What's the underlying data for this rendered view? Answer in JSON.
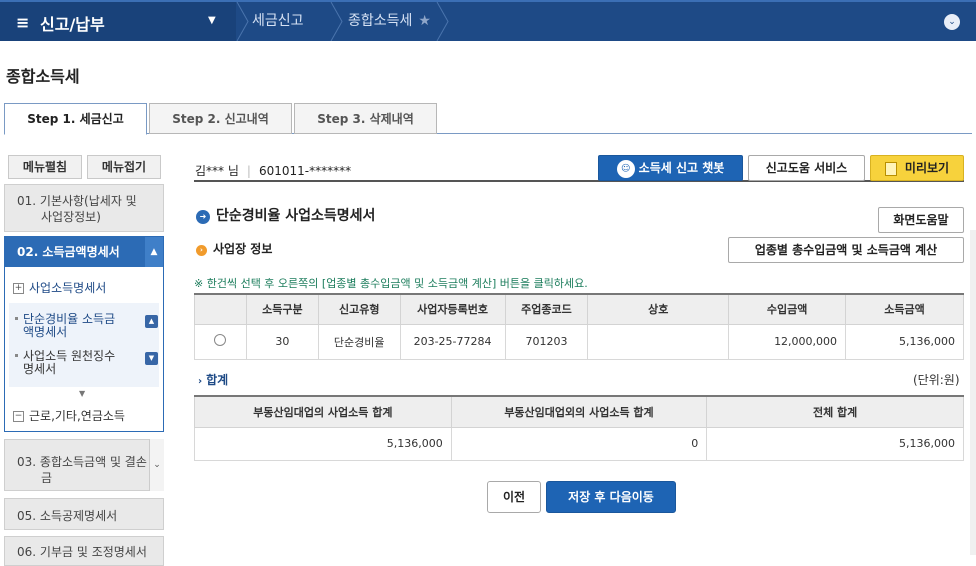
{
  "topnav": {
    "menu_title": "신고/납부",
    "breadcrumbs": [
      "세금신고",
      "종합소득세"
    ]
  },
  "page_title": "종합소득세",
  "tabs": [
    {
      "label": "Step 1. 세금신고",
      "active": true
    },
    {
      "label": "Step 2. 신고내역",
      "active": false
    },
    {
      "label": "Step 3. 삭제내역",
      "active": false
    }
  ],
  "sidebar": {
    "expand_all": "메뉴펼침",
    "collapse_all": "메뉴접기",
    "item1": "01. 기본사항(납세자 및 사업장정보)",
    "item1_l1": "01. 기본사항(납세자 및",
    "item1_l2": "사업장정보)",
    "group_head": "02. 소득금액명세서",
    "sub_business": "사업소득명세서",
    "sub1_l1": "단순경비율 소득금",
    "sub1_l2": "액명세서",
    "sub2_l1": "사업소득 원천징수",
    "sub2_l2": "명세서",
    "sub_other": "근로,기타,연금소득",
    "item3_l1": "03. 종합소득금액 및 결손",
    "item3_l2": "금",
    "item5": "05. 소득공제명세서",
    "item6": "06. 기부금 및 조정명세서"
  },
  "user": {
    "name": "김*** 님",
    "id": "601011-*******"
  },
  "buttons": {
    "chatbot": "소득세 신고 챗봇",
    "help_service": "신고도움 서비스",
    "preview": "미리보기",
    "screen_help": "화면도움말",
    "calc": "업종별 총수입금액 및 소득금액 계산",
    "prev": "이전",
    "save_next": "저장 후 다음이동"
  },
  "section_title": "단순경비율 사업소득명세서",
  "subsection_title": "사업장 정보",
  "notice": "※ 한건씩 선택 후 오른쪽의 [업종별 총수입금액 및 소득금액 계산] 버튼을 클릭하세요.",
  "business_table": {
    "headers": [
      "소득구분",
      "신고유형",
      "사업자등록번호",
      "주업종코드",
      "상호",
      "수입금액",
      "소득금액"
    ],
    "rows": [
      {
        "income_type": "30",
        "report_type": "단순경비율",
        "biz_no": "203-25-77284",
        "industry_code": "701203",
        "trade_name": "",
        "revenue": "12,000,000",
        "income": "5,136,000"
      }
    ]
  },
  "summary": {
    "title": "합계",
    "unit": "(단위:원)",
    "headers": [
      "부동산임대업의 사업소득 합계",
      "부동산임대업외의 사업소득 합계",
      "전체 합계"
    ],
    "values": [
      "5,136,000",
      "0",
      "5,136,000"
    ]
  }
}
